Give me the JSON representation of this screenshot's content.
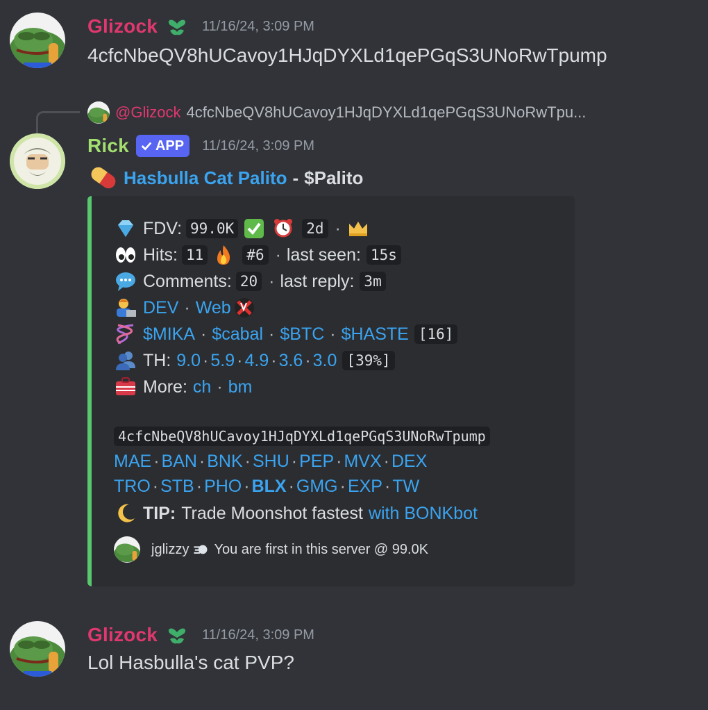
{
  "messages": [
    {
      "username": "Glizock",
      "timestamp": "11/16/24, 3:09 PM",
      "text": "4cfcNbeQV8hUCavoy1HJqDYXLd1qePGqS3UNoRwTpump"
    },
    {
      "username": "Rick",
      "bot_tag": "APP",
      "timestamp": "11/16/24, 3:09 PM",
      "reply": {
        "mention": "@Glizock",
        "text": "4cfcNbeQV8hUCavoy1HJqDYXLd1qePGqS3UNoRwTpu..."
      },
      "title": {
        "name": "Hasbulla Cat Palito",
        "separator": "-",
        "ticker": "$Palito"
      },
      "embed": {
        "fdv_label": "FDV:",
        "fdv_value": "99.0K",
        "age": "2d",
        "hits_label": "Hits:",
        "hits_value": "11",
        "rank": "#6",
        "last_seen_label": "last seen:",
        "last_seen_value": "15s",
        "comments_label": "Comments:",
        "comments_value": "20",
        "last_reply_label": "last reply:",
        "last_reply_value": "3m",
        "dev_link": "DEV",
        "web_link": "Web",
        "tickers": [
          "$MIKA",
          "$cabal",
          "$BTC",
          "$HASTE"
        ],
        "tickers_count": "[16]",
        "th_label": "TH:",
        "th_values": [
          "9.0",
          "5.9",
          "4.9",
          "3.6",
          "3.0"
        ],
        "th_pct": "[39%]",
        "more_label": "More:",
        "more_links": [
          "ch",
          "bm"
        ],
        "contract": "4cfcNbeQV8hUCavoy1HJqDYXLd1qePGqS3UNoRwTpump",
        "links_row1": [
          "MAE",
          "BAN",
          "BNK",
          "SHU",
          "PEP",
          "MVX",
          "DEX"
        ],
        "links_row2": [
          "TRO",
          "STB",
          "PHO",
          "BLX",
          "GMG",
          "EXP",
          "TW"
        ],
        "tip_label": "TIP:",
        "tip_text": "Trade Moonshot fastest",
        "tip_link": "with BONKbot",
        "footer_user": "jglizzy",
        "footer_text": "You are first in this server @ 99.0K"
      }
    },
    {
      "username": "Glizock",
      "timestamp": "11/16/24, 3:09 PM",
      "text": "Lol Hasbulla's cat PVP?"
    }
  ],
  "colors": {
    "background": "#313338",
    "embed_bg": "#2b2d31",
    "embed_border": "#57c86e",
    "link": "#3ba4f0",
    "glizock_name": "#e0386e",
    "rick_name": "#a3df6f",
    "app_tag": "#5865f2"
  },
  "icons": [
    "pepe-avatar-icon",
    "rick-avatar-icon",
    "heart-role-icon",
    "checkmark-icon",
    "pill-icon",
    "gem-icon",
    "check-mark-button-icon",
    "alarm-clock-icon",
    "crown-icon",
    "eyes-icon",
    "fire-icon",
    "speech-bubble-icon",
    "technologist-icon",
    "no-web-icon",
    "dna-icon",
    "busts-icon",
    "toolbox-icon",
    "crescent-moon-icon",
    "dash-icon"
  ]
}
